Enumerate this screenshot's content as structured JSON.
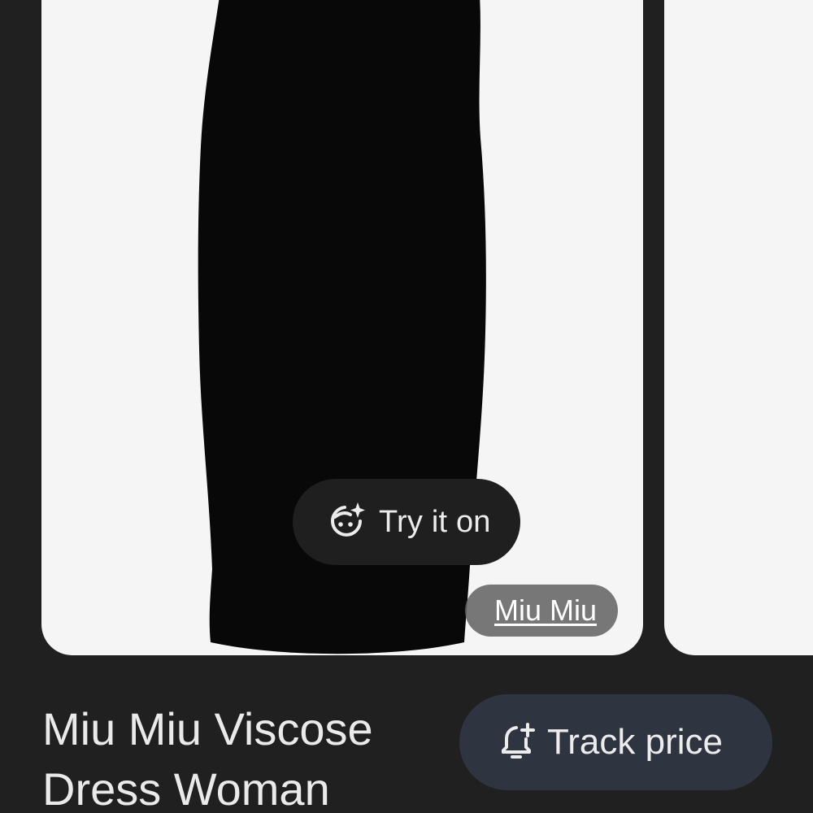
{
  "product": {
    "image_alt": "Black ribbed midi dress",
    "try_on_label": "Try it on",
    "brand_label": "Miu Miu",
    "title_line1": "Miu Miu Viscose",
    "title_line2": "Dress Woman",
    "track_price_label": "Track price"
  },
  "icons": {
    "try_on": "face-sparkle-icon",
    "track_price": "bell-plus-icon"
  },
  "colors": {
    "background": "#202020",
    "card": "#f5f5f5",
    "dress": "#080808",
    "track_button": "#2f3441",
    "try_on_button": "#1f1f1f",
    "brand_chip": "#606060"
  }
}
